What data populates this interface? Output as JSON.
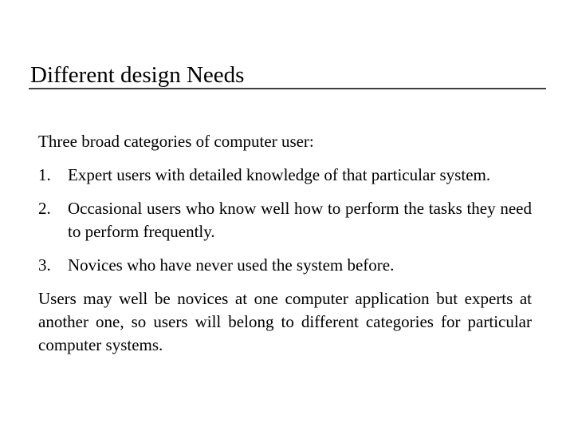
{
  "slide": {
    "title": "Different design Needs",
    "intro": "Three broad categories of computer user:",
    "list": [
      {
        "number": "1.",
        "text": "Expert users with detailed knowledge of that particular system."
      },
      {
        "number": "2.",
        "text": "Occasional users who know well how to perform the tasks they need to perform frequently."
      },
      {
        "number": "3.",
        "text": "Novices who have never used the system before."
      }
    ],
    "closing": "Users may well be novices at one computer application but experts at another one, so users will belong to different categories for particular computer systems."
  }
}
